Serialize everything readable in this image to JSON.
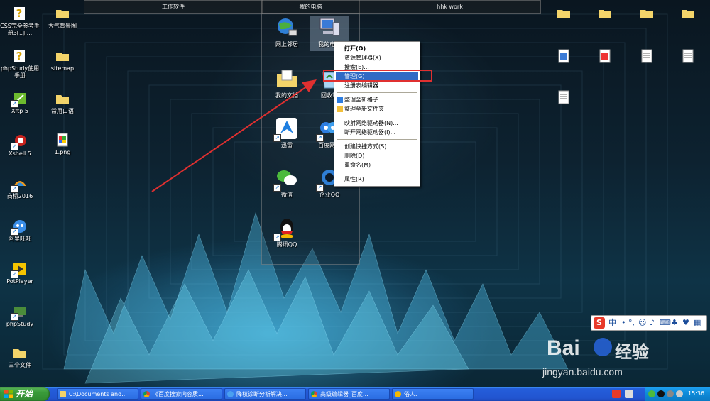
{
  "fences": [
    {
      "title": "工作软件"
    },
    {
      "title": "我的电脑"
    },
    {
      "title": "hhk work"
    }
  ],
  "desktop_left": [
    {
      "label": "CSS完全参考手册3[1]....",
      "icon": "help-file-icon"
    },
    {
      "label": "phpStudy使用手册",
      "icon": "help-file-icon"
    },
    {
      "label": "Xftp 5",
      "icon": "xftp-icon"
    },
    {
      "label": "Xshell 5",
      "icon": "xshell-icon"
    },
    {
      "label": "商桥2016",
      "icon": "shangqiao-icon"
    },
    {
      "label": "阿里旺旺",
      "icon": "aliwangwang-icon"
    },
    {
      "label": "PotPlayer",
      "icon": "potplayer-icon"
    },
    {
      "label": "phpStudy",
      "icon": "phpstudy-icon"
    },
    {
      "label": "三个文件",
      "icon": "folder-icon"
    }
  ],
  "desktop_second": [
    {
      "label": "大气背景图",
      "icon": "folder-icon"
    },
    {
      "label": "sitemap",
      "icon": "folder-icon"
    },
    {
      "label": "常用口语",
      "icon": "folder-icon"
    },
    {
      "label": "1.png",
      "icon": "png-file-icon"
    }
  ],
  "fence_icons": [
    {
      "label": "网上邻居",
      "icon": "network-icon"
    },
    {
      "label": "我的电...",
      "icon": "my-computer-icon"
    },
    {
      "label": "我的文档",
      "icon": "my-documents-icon"
    },
    {
      "label": "回收站",
      "icon": "recycle-bin-icon"
    },
    {
      "label": "迅雷",
      "icon": "xunlei-icon"
    },
    {
      "label": "百度网...",
      "icon": "baidu-netdisk-icon"
    },
    {
      "label": "微信",
      "icon": "wechat-icon"
    },
    {
      "label": "企业QQ",
      "icon": "enterprise-qq-icon"
    },
    {
      "label": "腾讯QQ",
      "icon": "qq-icon"
    }
  ],
  "context_menu": {
    "items": [
      {
        "label": "打开(O)",
        "bold": true
      },
      {
        "label": "资源管理器(X)"
      },
      {
        "label": "搜索(E)..."
      },
      {
        "label": "管理(G)",
        "selected": true
      },
      {
        "label": "注册表编辑器"
      },
      {
        "label": "整理至新格子"
      },
      {
        "label": "整理至新文件夹"
      },
      {
        "label": "映射网络驱动器(N)..."
      },
      {
        "label": "断开网络驱动器(I)..."
      },
      {
        "label": "创建快捷方式(S)"
      },
      {
        "label": "删除(D)"
      },
      {
        "label": "重命名(M)"
      },
      {
        "label": "属性(R)"
      }
    ]
  },
  "taskbar": {
    "start_label": "开始",
    "tasks": [
      {
        "label": "C:\\Documents and...",
        "icon": "folder-icon"
      },
      {
        "label": "《百度搜索内容质...",
        "icon": "chrome-icon"
      },
      {
        "label": "降权诊断分析解决...",
        "icon": "ie-icon"
      },
      {
        "label": "高级编辑器_百度...",
        "icon": "chrome-icon"
      },
      {
        "label": "俗人.",
        "icon": "qq-icon"
      }
    ],
    "clock": "15:36"
  },
  "ime_bar": {
    "logo": "S",
    "mode": "中"
  },
  "watermark": {
    "brand": "Bai",
    "brand2": "经验",
    "url": "jingyan.baidu.com"
  },
  "colors": {
    "selection": "#316ac5",
    "highlight_box": "#e03030",
    "arrow": "#e03030",
    "taskbar": "#245edb",
    "start": "#3a9b3a"
  }
}
